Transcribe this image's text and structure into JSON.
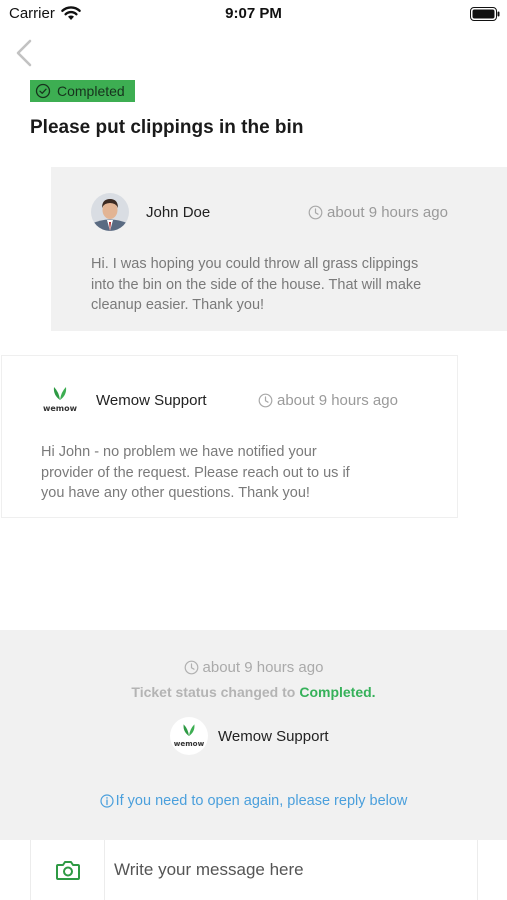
{
  "status_bar": {
    "carrier": "Carrier",
    "time": "9:07 PM"
  },
  "ticket": {
    "status_badge": "Completed",
    "title": "Please put clippings in the bin"
  },
  "messages": [
    {
      "author": "John Doe",
      "time": "about 9 hours ago",
      "lines": [
        "Hi. I was hoping you could throw all grass clippings",
        "into the bin on the side of the house. That will make",
        "cleanup easier. Thank you!"
      ]
    },
    {
      "author": "Wemow Support",
      "time": "about 9 hours ago",
      "lines": [
        "Hi John - no problem we have notified your",
        "provider of the request.  Please reach out to us if",
        "you have any other questions. Thank you!"
      ]
    }
  ],
  "status_change": {
    "time": "about 9 hours ago",
    "label": "Ticket status changed to",
    "value": "Completed.",
    "agent": "Wemow Support",
    "reopen_hint": "If you need to open again, please reply below"
  },
  "composer": {
    "placeholder": "Write your message here"
  },
  "icons": [
    "wifi-icon",
    "battery-icon",
    "back-chevron-icon",
    "check-circle-icon",
    "clock-icon",
    "info-icon",
    "camera-icon",
    "wemow-logo-icon"
  ],
  "colors": {
    "accent_green": "#3dae52",
    "status_green": "#36b15a",
    "link_blue": "#4a9fdc",
    "panel_gray": "#f1f1f1"
  }
}
